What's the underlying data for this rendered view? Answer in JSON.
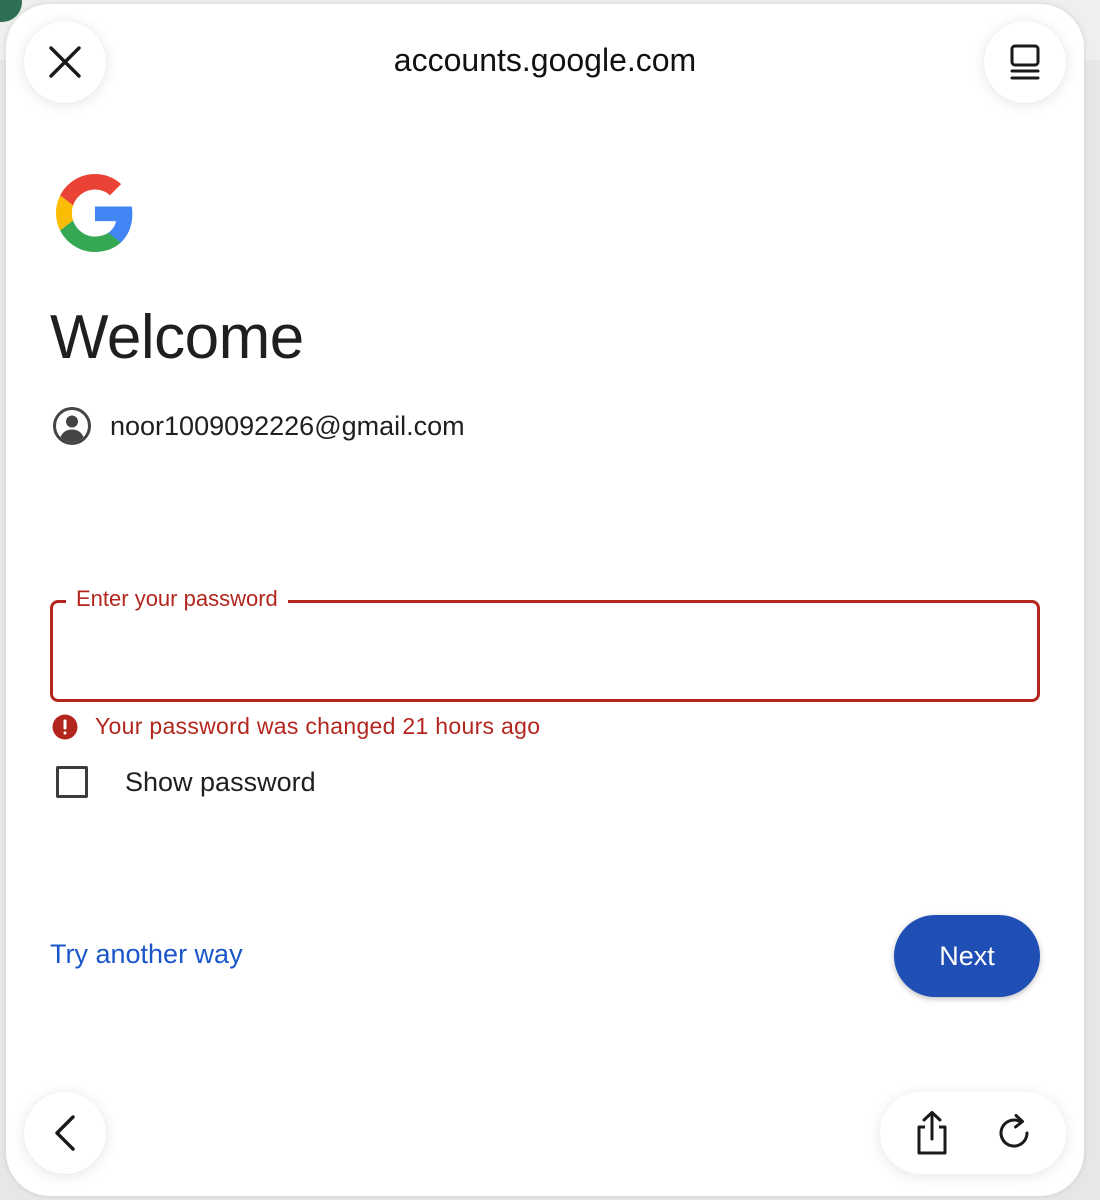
{
  "browser": {
    "url": "accounts.google.com"
  },
  "signin": {
    "heading": "Welcome",
    "account_email": "noor1009092226@gmail.com",
    "password_field": {
      "label": "Enter your password",
      "value": ""
    },
    "error_message": "Your password was changed 21 hours ago",
    "show_password_label": "Show password",
    "show_password_checked": false,
    "try_another_way_label": "Try another way",
    "next_label": "Next"
  },
  "colors": {
    "error": "#b3261e",
    "primary_button": "#1f4fb5",
    "link": "#1a56c9"
  },
  "icons": {
    "close": "close-icon",
    "reader": "reader-view-icon",
    "back": "chevron-left-icon",
    "share": "share-icon",
    "reload": "reload-icon",
    "logo": "google-g-logo",
    "account": "account-circle-icon",
    "error": "error-icon"
  }
}
